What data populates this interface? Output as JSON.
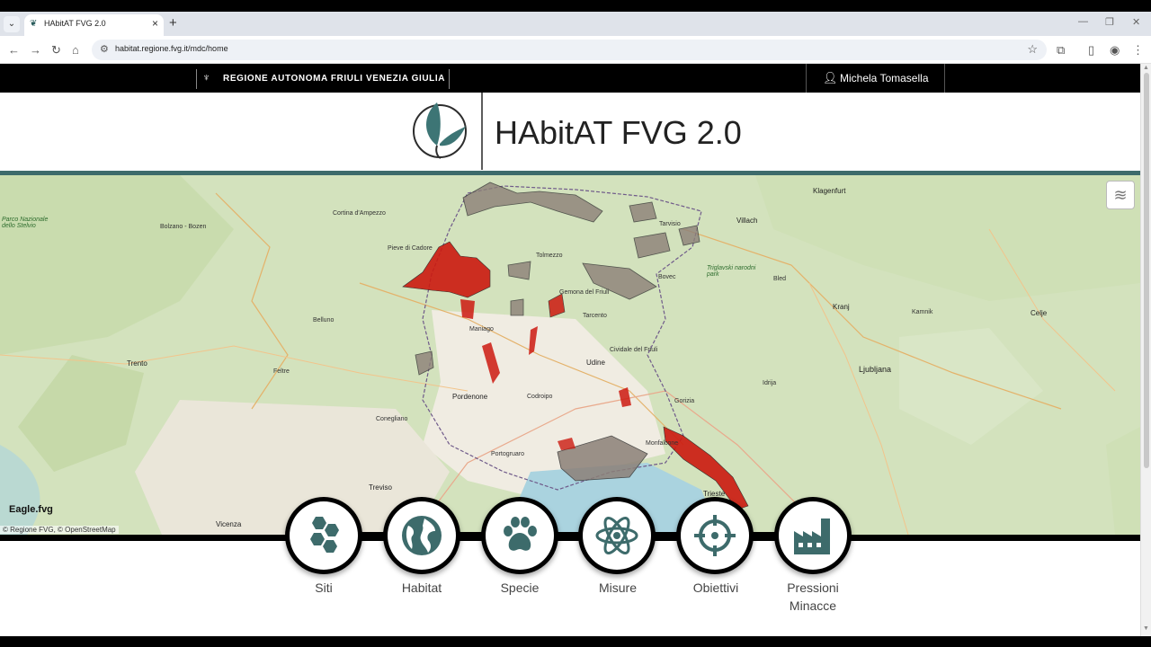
{
  "browser": {
    "tab_title": "HAbitAT FVG 2.0",
    "url": "habitat.regione.fvg.it/mdc/home"
  },
  "header": {
    "region_name": "REGIONE AUTONOMA FRIULI VENEZIA GIULIA",
    "user_name": "Michela Tomasella",
    "app_title": "HAbitAT FVG 2.0"
  },
  "map": {
    "attribution": "© Regione FVG, © OpenStreetMap",
    "brand": "Eagle.fvg",
    "labels": {
      "klagenfurt": "Klagenfurt",
      "villach": "Villach",
      "cortina": "Cortina d'Ampezzo",
      "bolzano": "Bolzano - Bozen",
      "tolmezzo": "Tolmezzo",
      "tarvisio": "Tarvisio",
      "bled": "Bled",
      "kranj": "Kranj",
      "ljubljana": "Ljubljana",
      "udine": "Udine",
      "pordenone": "Pordenone",
      "trento": "Trento",
      "belluno": "Belluno",
      "gorizia": "Gorizia",
      "trieste": "Trieste",
      "treviso": "Treviso",
      "vicenza": "Vicenza",
      "monfalcone": "Monfalcone",
      "pieve": "Pieve di Cadore",
      "gemona": "Gemona del Friuli",
      "cividale": "Cividale del Friuli",
      "tarcento": "Tarcento",
      "maniago": "Maniago",
      "feltre": "Feltre",
      "conegliano": "Conegliano",
      "portogruaro": "Portogruaro",
      "codroipo": "Codroipo",
      "celje": "Celje",
      "kamnik": "Kamnik",
      "bovec": "Bovec",
      "idrija": "Idrija",
      "triglav": "Triglavski narodni park",
      "stelvio": "Parco Nazionale dello Stelvio"
    }
  },
  "menu": {
    "items": [
      {
        "label": "Siti"
      },
      {
        "label": "Habitat"
      },
      {
        "label": "Specie"
      },
      {
        "label": "Misure"
      },
      {
        "label": "Obiettivi"
      },
      {
        "label": "Pressioni Minacce"
      }
    ]
  },
  "colors": {
    "accent": "#3d6b6b",
    "habitat_red": "#cc1a10",
    "protected_grey": "#8c8078"
  }
}
